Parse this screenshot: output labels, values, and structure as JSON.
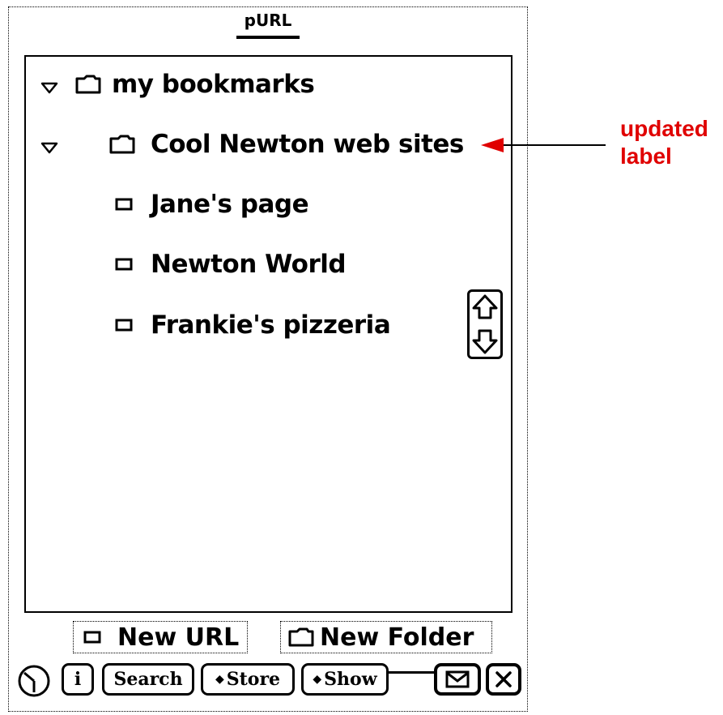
{
  "app": {
    "title": "pURL"
  },
  "tree": [
    {
      "type": "folder",
      "label": "my bookmarks",
      "expanded": true,
      "icon": "folder-icon"
    },
    {
      "type": "folder",
      "label": "Cool Newton web sites",
      "expanded": true,
      "icon": "folder-icon"
    },
    {
      "type": "url",
      "label": "Jane's page",
      "icon": "url-icon"
    },
    {
      "type": "url",
      "label": "Newton World",
      "icon": "url-icon"
    },
    {
      "type": "url",
      "label": "Frankie's pizzeria",
      "icon": "url-icon"
    }
  ],
  "actions": {
    "new_url": "New URL",
    "new_folder": "New Folder"
  },
  "toolbar": {
    "info": "i",
    "search": "Search",
    "store": "Store",
    "show": "Show",
    "icons": [
      "clock-icon",
      "envelope-icon",
      "close-icon"
    ]
  },
  "annotation": {
    "line1": "updated",
    "line2": "label",
    "color": "#e00000"
  }
}
